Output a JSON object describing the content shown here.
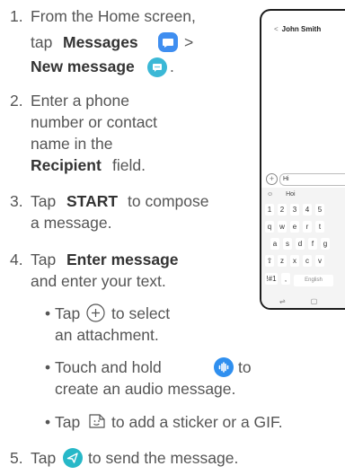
{
  "steps": {
    "s1": {
      "num": "1.",
      "line1": "From the Home screen,",
      "pre": "tap",
      "app": "Messages",
      "sep": ">",
      "new": "New message"
    },
    "s2": {
      "num": "2.",
      "line1": "Enter a phone",
      "line2": "number or contact",
      "line3": "name in the",
      "field": "Recipient",
      "field_suffix": "field."
    },
    "s3": {
      "num": "3.",
      "pre": "Tap",
      "key": "START",
      "post": "to compose",
      "line2": "a message."
    },
    "s4": {
      "num": "4.",
      "pre": "Tap",
      "key": "Enter message",
      "line2": "and enter your text.",
      "bullets": [
        {
          "pre": "Tap",
          "post": "to select",
          "line2": "an attachment."
        },
        {
          "pre": "Touch and hold",
          "post": "to",
          "line2": "create an audio message."
        },
        {
          "pre": "Tap",
          "post": "to add a sticker or a GIF."
        }
      ]
    },
    "s5": {
      "num": "5.",
      "pre": "Tap",
      "post": "to send the message."
    }
  },
  "phone": {
    "contact": "John Smith",
    "input_text": "Hi",
    "suggestion": "Hoi",
    "row_numbers": [
      "1",
      "2",
      "3",
      "4",
      "5"
    ],
    "row_q": [
      "q",
      "w",
      "e",
      "r",
      "t"
    ],
    "row_a": [
      "a",
      "s",
      "d",
      "f",
      "g"
    ],
    "row_z": [
      "⇧",
      "z",
      "x",
      "c",
      "v"
    ],
    "row_bottom": [
      "!#1",
      ",",
      "English"
    ]
  },
  "colors": {
    "messages_icon": "#3f8ef0",
    "new_message_icon": "#3bb8d6",
    "audio_icon": "#2f8fef",
    "send_icon": "#27b8c8",
    "body_text": "#555555"
  },
  "icons": [
    "messages-app-icon",
    "new-message-icon",
    "plus-circle-icon",
    "audio-record-icon",
    "sticker-icon",
    "send-icon"
  ]
}
